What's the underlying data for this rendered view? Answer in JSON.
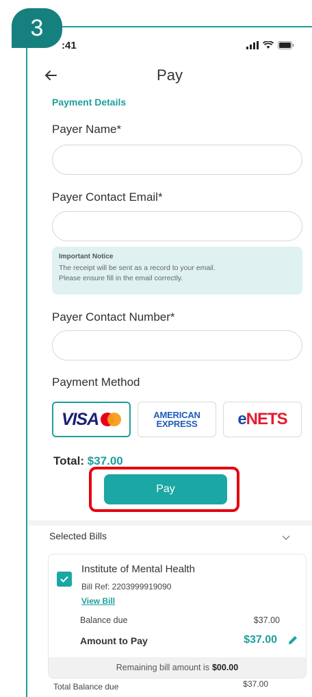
{
  "step_badge": "3",
  "status_bar": {
    "time": ":41"
  },
  "header": {
    "title": "Pay"
  },
  "form": {
    "section_title": "Payment Details",
    "payer_name_label": "Payer Name*",
    "payer_name_value": "",
    "payer_email_label": "Payer Contact Email*",
    "payer_email_value": "",
    "notice_title": "Important Notice",
    "notice_line1": "The receipt will be sent as a record to your email.",
    "notice_line2": "Please ensure fill in the email correctly.",
    "payer_number_label": "Payer Contact Number*",
    "payer_number_value": "",
    "payment_method_label": "Payment Method"
  },
  "payment_methods": {
    "visa": "VISA",
    "amex_line1": "AMERICAN",
    "amex_line2": "EXPRESS",
    "enets_prefix": "e",
    "enets_main": "NETS",
    "selected": "visa"
  },
  "total": {
    "label": "Total:",
    "amount": "$37.00"
  },
  "pay_button": "Pay",
  "selected_bills": {
    "header": "Selected Bills",
    "bill": {
      "institution": "Institute of Mental Health",
      "bill_ref": "Bill Ref: 2203999919090",
      "view_link": "View Bill",
      "balance_label": "Balance due",
      "balance_value": "$37.00",
      "amount_label": "Amount to Pay",
      "amount_value": "$37.00",
      "remaining_text": "Remaining bill amount is",
      "remaining_value": "$00.00"
    },
    "total_balance_label": "Total Balance due",
    "total_balance_value": "$37.00"
  },
  "colors": {
    "accent": "#1ba7a3",
    "highlight": "#e3000f",
    "badge": "#16807f"
  }
}
